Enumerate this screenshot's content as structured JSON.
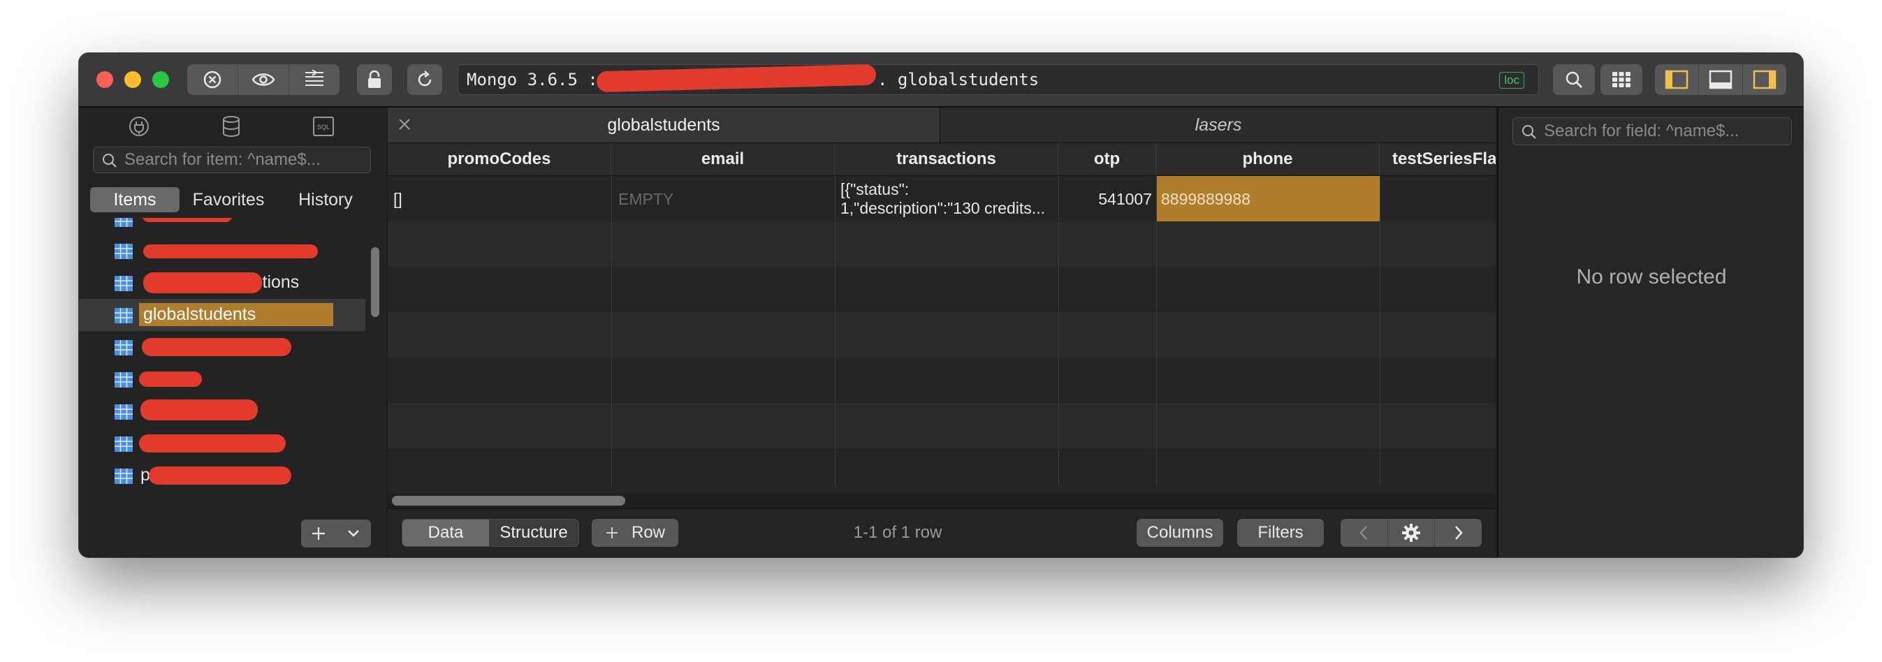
{
  "toolbar": {
    "address_prefix": "Mongo 3.6.5 :",
    "address_collection": ". globalstudents",
    "loc_badge": "loc"
  },
  "sidebar": {
    "search_placeholder": "Search for item: ^name$...",
    "tabs": [
      "Items",
      "Favorites",
      "History"
    ],
    "active_tab": "Items",
    "items": [
      {
        "label": ""
      },
      {
        "label": ""
      },
      {
        "label": "ctions"
      },
      {
        "label": "globalstudents",
        "selected": true
      },
      {
        "label": ""
      },
      {
        "label": ""
      },
      {
        "label": ""
      },
      {
        "label": ""
      },
      {
        "label": "p"
      }
    ]
  },
  "tabs": [
    {
      "label": "globalstudents",
      "active": true
    },
    {
      "label": "lasers",
      "active": false
    }
  ],
  "table": {
    "columns": [
      "promoCodes",
      "email",
      "transactions",
      "otp",
      "phone",
      "testSeriesFla"
    ],
    "row": {
      "promoCodes": "[]",
      "email": "EMPTY",
      "transactions_line1": "[{\"status\":",
      "transactions_line2": "1,\"description\":\"130 credits...",
      "otp": "541007",
      "phone": "8899889988",
      "testSeriesFla": ""
    }
  },
  "bottom_bar": {
    "data_label": "Data",
    "structure_label": "Structure",
    "add_row_label": "Row",
    "row_count": "1-1 of 1 row",
    "columns_label": "Columns",
    "filters_label": "Filters"
  },
  "right_panel": {
    "search_placeholder": "Search for field: ^name$...",
    "empty_message": "No row selected"
  },
  "colors": {
    "accent": "#b07d2c",
    "redaction": "#e23a2c",
    "loc_green": "#4cc35c"
  }
}
